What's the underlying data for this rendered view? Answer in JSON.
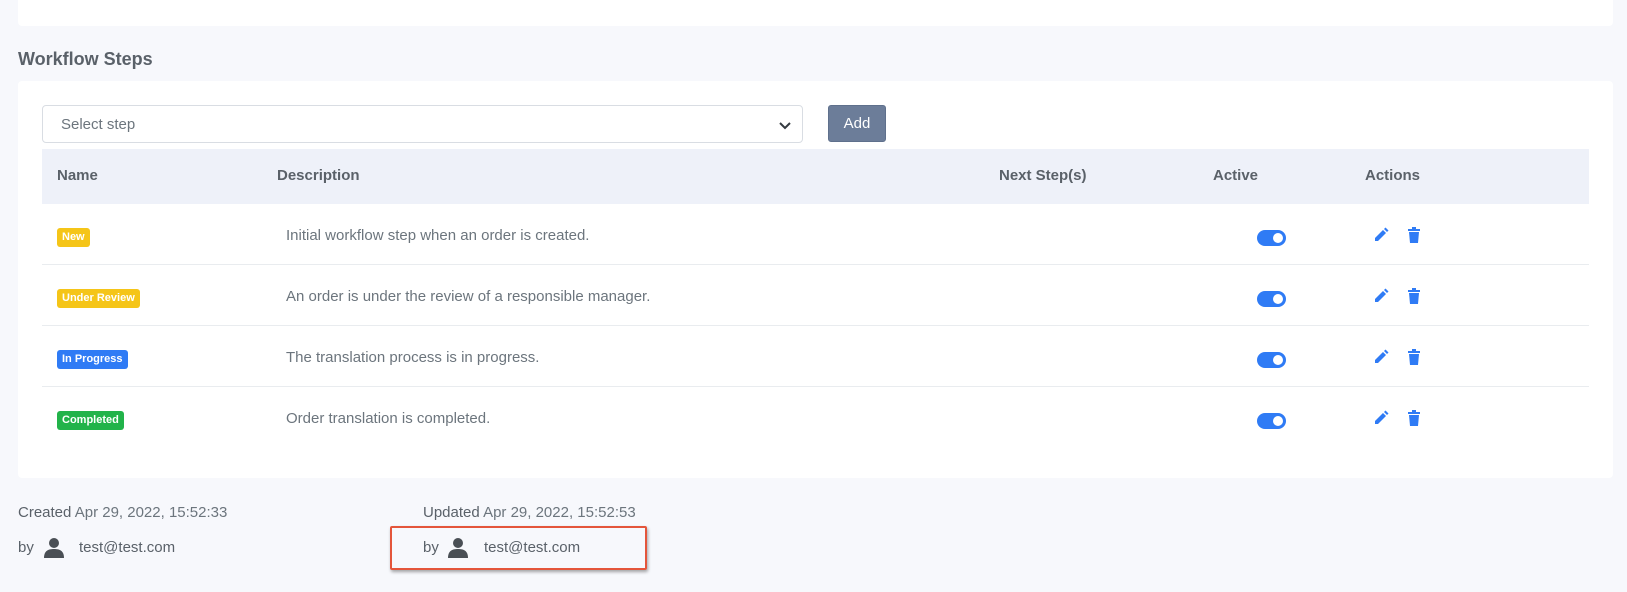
{
  "section_title": "Workflow Steps",
  "select": {
    "placeholder": "Select step"
  },
  "add_label": "Add",
  "columns": [
    "Name",
    "Description",
    "Next Step(s)",
    "Active",
    "Actions"
  ],
  "rows": [
    {
      "name": "New",
      "badge_color": "#f5c518",
      "description": "Initial workflow step when an order is created.",
      "next_steps": "",
      "active": true
    },
    {
      "name": "Under Review",
      "badge_color": "#f5c518",
      "description": "An order is under the review of a responsible manager.",
      "next_steps": "",
      "active": true
    },
    {
      "name": "In Progress",
      "badge_color": "#2f7bf5",
      "description": "The translation process is in progress.",
      "next_steps": "",
      "active": true
    },
    {
      "name": "Completed",
      "badge_color": "#22b34a",
      "description": "Order translation is completed.",
      "next_steps": "",
      "active": true
    }
  ],
  "icons": {
    "edit": "pencil-icon",
    "delete": "trash-icon",
    "user": "user-icon",
    "chevron": "chevron-down-icon"
  },
  "colors": {
    "accent": "#2f7bf5",
    "highlight_border": "#e4553b"
  },
  "footer": {
    "created_label": "Created",
    "created_value": "Apr 29, 2022, 15:52:33",
    "created_by_label": "by",
    "created_by": "test@test.com",
    "updated_label": "Updated",
    "updated_value": "Apr 29, 2022, 15:52:53",
    "updated_by_label": "by",
    "updated_by": "test@test.com"
  }
}
